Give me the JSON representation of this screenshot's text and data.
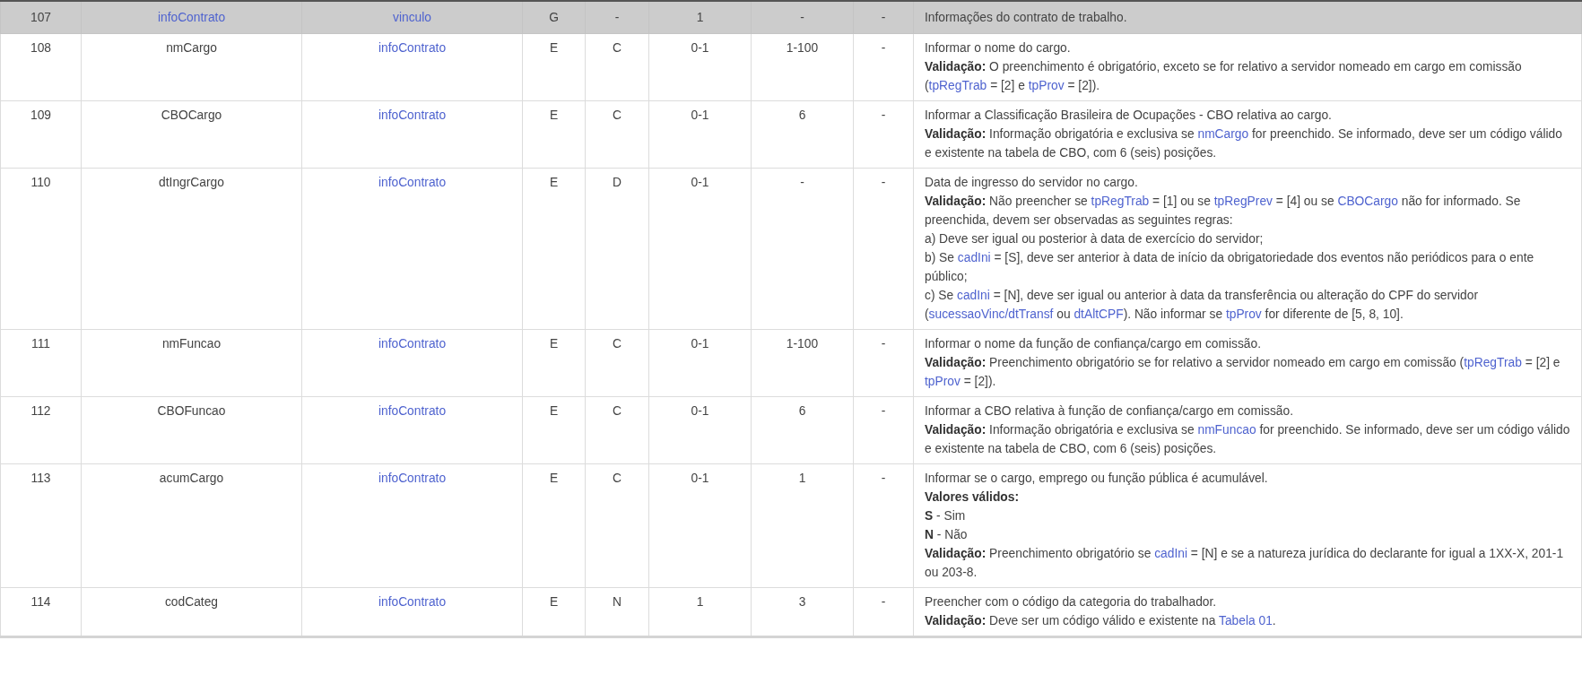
{
  "table": {
    "rows": [
      {
        "kind": "group",
        "cells": [
          {
            "text": "107",
            "link": false
          },
          {
            "text": "infoContrato",
            "link": true
          },
          {
            "text": "vinculo",
            "link": true
          },
          {
            "text": "G",
            "link": false
          },
          {
            "text": "-",
            "link": false
          },
          {
            "text": "1",
            "link": false
          },
          {
            "text": "-",
            "link": false
          },
          {
            "text": "-",
            "link": false
          }
        ],
        "description": [
          [
            {
              "kind": "text",
              "text": "Informações do contrato de trabalho."
            }
          ]
        ]
      },
      {
        "kind": "element",
        "cells": [
          {
            "text": "108",
            "link": false
          },
          {
            "text": "nmCargo",
            "link": false
          },
          {
            "text": "infoContrato",
            "link": true
          },
          {
            "text": "E",
            "link": false
          },
          {
            "text": "C",
            "link": false
          },
          {
            "text": "0-1",
            "link": false
          },
          {
            "text": "1-100",
            "link": false
          },
          {
            "text": "-",
            "link": false
          }
        ],
        "description": [
          [
            {
              "kind": "text",
              "text": "Informar o nome do cargo."
            }
          ],
          [
            {
              "kind": "bold",
              "text": "Validação:"
            },
            {
              "kind": "text",
              "text": " O preenchimento é obrigatório, exceto se for relativo a servidor nomeado em cargo em comissão ("
            },
            {
              "kind": "link",
              "text": "tpRegTrab"
            },
            {
              "kind": "text",
              "text": " = [2] e "
            },
            {
              "kind": "link",
              "text": "tpProv"
            },
            {
              "kind": "text",
              "text": " = [2])."
            }
          ]
        ]
      },
      {
        "kind": "element",
        "cells": [
          {
            "text": "109",
            "link": false
          },
          {
            "text": "CBOCargo",
            "link": false
          },
          {
            "text": "infoContrato",
            "link": true
          },
          {
            "text": "E",
            "link": false
          },
          {
            "text": "C",
            "link": false
          },
          {
            "text": "0-1",
            "link": false
          },
          {
            "text": "6",
            "link": false
          },
          {
            "text": "-",
            "link": false
          }
        ],
        "description": [
          [
            {
              "kind": "text",
              "text": "Informar a Classificação Brasileira de Ocupações - CBO relativa ao cargo."
            }
          ],
          [
            {
              "kind": "bold",
              "text": "Validação:"
            },
            {
              "kind": "text",
              "text": " Informação obrigatória e exclusiva se "
            },
            {
              "kind": "link",
              "text": "nmCargo"
            },
            {
              "kind": "text",
              "text": " for preenchido. Se informado, deve ser um código válido e existente na tabela de CBO, com 6 (seis) posições."
            }
          ]
        ]
      },
      {
        "kind": "element",
        "cells": [
          {
            "text": "110",
            "link": false
          },
          {
            "text": "dtIngrCargo",
            "link": false
          },
          {
            "text": "infoContrato",
            "link": true
          },
          {
            "text": "E",
            "link": false
          },
          {
            "text": "D",
            "link": false
          },
          {
            "text": "0-1",
            "link": false
          },
          {
            "text": "-",
            "link": false
          },
          {
            "text": "-",
            "link": false
          }
        ],
        "description": [
          [
            {
              "kind": "text",
              "text": "Data de ingresso do servidor no cargo."
            }
          ],
          [
            {
              "kind": "bold",
              "text": "Validação:"
            },
            {
              "kind": "text",
              "text": " Não preencher se "
            },
            {
              "kind": "link",
              "text": "tpRegTrab"
            },
            {
              "kind": "text",
              "text": " = [1] ou se "
            },
            {
              "kind": "link",
              "text": "tpRegPrev"
            },
            {
              "kind": "text",
              "text": " = [4] ou se "
            },
            {
              "kind": "link",
              "text": "CBOCargo"
            },
            {
              "kind": "text",
              "text": " não for informado. Se preenchida, devem ser observadas as seguintes regras:"
            }
          ],
          [
            {
              "kind": "text",
              "text": "a) Deve ser igual ou posterior à data de exercício do servidor;"
            }
          ],
          [
            {
              "kind": "text",
              "text": "b) Se "
            },
            {
              "kind": "link",
              "text": "cadIni"
            },
            {
              "kind": "text",
              "text": " = [S], deve ser anterior à data de início da obrigatoriedade dos eventos não periódicos para o ente público;"
            }
          ],
          [
            {
              "kind": "text",
              "text": "c) Se "
            },
            {
              "kind": "link",
              "text": "cadIni"
            },
            {
              "kind": "text",
              "text": " = [N], deve ser igual ou anterior à data da transferência ou alteração do CPF do servidor ("
            },
            {
              "kind": "link",
              "text": "sucessaoVinc/dtTransf"
            },
            {
              "kind": "text",
              "text": " ou "
            },
            {
              "kind": "link",
              "text": "dtAltCPF"
            },
            {
              "kind": "text",
              "text": "). Não informar se "
            },
            {
              "kind": "link",
              "text": "tpProv"
            },
            {
              "kind": "text",
              "text": " for diferente de [5, 8, 10]."
            }
          ]
        ]
      },
      {
        "kind": "element",
        "cells": [
          {
            "text": "111",
            "link": false
          },
          {
            "text": "nmFuncao",
            "link": false
          },
          {
            "text": "infoContrato",
            "link": true
          },
          {
            "text": "E",
            "link": false
          },
          {
            "text": "C",
            "link": false
          },
          {
            "text": "0-1",
            "link": false
          },
          {
            "text": "1-100",
            "link": false
          },
          {
            "text": "-",
            "link": false
          }
        ],
        "description": [
          [
            {
              "kind": "text",
              "text": "Informar o nome da função de confiança/cargo em comissão."
            }
          ],
          [
            {
              "kind": "bold",
              "text": "Validação:"
            },
            {
              "kind": "text",
              "text": " Preenchimento obrigatório se for relativo a servidor nomeado em cargo em comissão ("
            },
            {
              "kind": "link",
              "text": "tpRegTrab"
            },
            {
              "kind": "text",
              "text": " = [2] e "
            },
            {
              "kind": "link",
              "text": "tpProv"
            },
            {
              "kind": "text",
              "text": " = [2])."
            }
          ]
        ]
      },
      {
        "kind": "element",
        "cells": [
          {
            "text": "112",
            "link": false
          },
          {
            "text": "CBOFuncao",
            "link": false
          },
          {
            "text": "infoContrato",
            "link": true
          },
          {
            "text": "E",
            "link": false
          },
          {
            "text": "C",
            "link": false
          },
          {
            "text": "0-1",
            "link": false
          },
          {
            "text": "6",
            "link": false
          },
          {
            "text": "-",
            "link": false
          }
        ],
        "description": [
          [
            {
              "kind": "text",
              "text": "Informar a CBO relativa à função de confiança/cargo em comissão."
            }
          ],
          [
            {
              "kind": "bold",
              "text": "Validação:"
            },
            {
              "kind": "text",
              "text": " Informação obrigatória e exclusiva se "
            },
            {
              "kind": "link",
              "text": "nmFuncao"
            },
            {
              "kind": "text",
              "text": " for preenchido. Se informado, deve ser um código válido e existente na tabela de CBO, com 6 (seis) posições."
            }
          ]
        ]
      },
      {
        "kind": "element",
        "cells": [
          {
            "text": "113",
            "link": false
          },
          {
            "text": "acumCargo",
            "link": false
          },
          {
            "text": "infoContrato",
            "link": true
          },
          {
            "text": "E",
            "link": false
          },
          {
            "text": "C",
            "link": false
          },
          {
            "text": "0-1",
            "link": false
          },
          {
            "text": "1",
            "link": false
          },
          {
            "text": "-",
            "link": false
          }
        ],
        "description": [
          [
            {
              "kind": "text",
              "text": "Informar se o cargo, emprego ou função pública é acumulável."
            }
          ],
          [
            {
              "kind": "bold",
              "text": "Valores válidos:"
            }
          ],
          [
            {
              "kind": "bold",
              "text": "S"
            },
            {
              "kind": "text",
              "text": " - Sim"
            }
          ],
          [
            {
              "kind": "bold",
              "text": "N"
            },
            {
              "kind": "text",
              "text": " - Não"
            }
          ],
          [
            {
              "kind": "bold",
              "text": "Validação:"
            },
            {
              "kind": "text",
              "text": " Preenchimento obrigatório se "
            },
            {
              "kind": "link",
              "text": "cadIni"
            },
            {
              "kind": "text",
              "text": " = [N] e se a natureza jurídica do declarante for igual a 1XX-X, 201-1 ou 203-8."
            }
          ]
        ]
      },
      {
        "kind": "element",
        "cells": [
          {
            "text": "114",
            "link": false
          },
          {
            "text": "codCateg",
            "link": false
          },
          {
            "text": "infoContrato",
            "link": true
          },
          {
            "text": "E",
            "link": false
          },
          {
            "text": "N",
            "link": false
          },
          {
            "text": "1",
            "link": false
          },
          {
            "text": "3",
            "link": false
          },
          {
            "text": "-",
            "link": false
          }
        ],
        "description": [
          [
            {
              "kind": "text",
              "text": "Preencher com o código da categoria do trabalhador."
            }
          ],
          [
            {
              "kind": "bold",
              "text": "Validação:"
            },
            {
              "kind": "text",
              "text": " Deve ser um código válido e existente na "
            },
            {
              "kind": "link",
              "text": "Tabela 01"
            },
            {
              "kind": "text",
              "text": "."
            }
          ]
        ]
      }
    ]
  }
}
